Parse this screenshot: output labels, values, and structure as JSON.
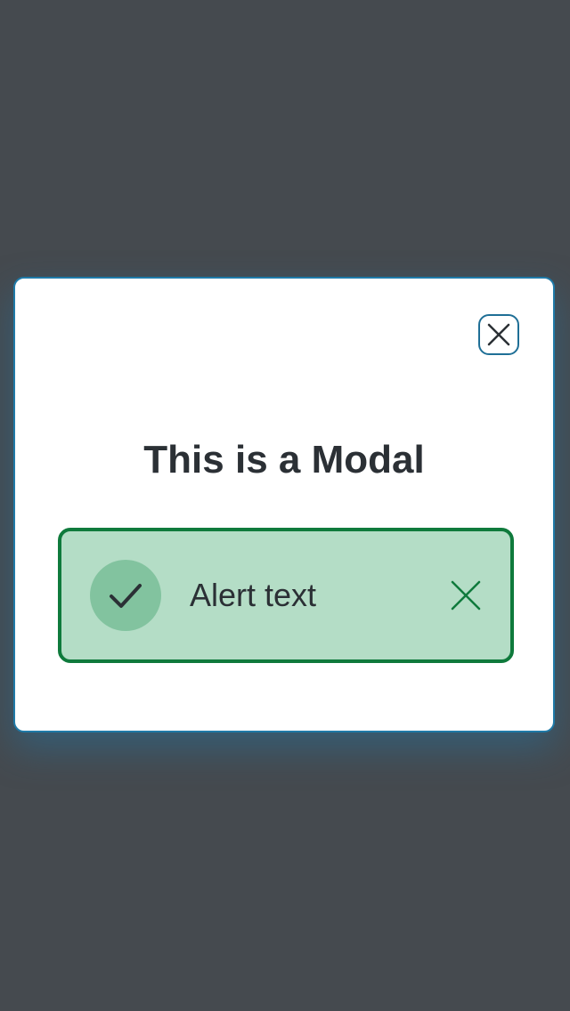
{
  "modal": {
    "title": "This is a Modal",
    "close_icon": "close-icon"
  },
  "alert": {
    "text": "Alert text",
    "status_icon": "checkmark-icon",
    "close_icon": "close-icon",
    "type": "success"
  },
  "colors": {
    "backdrop": "#454a4f",
    "modal_border": "#1f7aa8",
    "alert_background": "#b4ddc6",
    "alert_border": "#0f7a3c",
    "alert_icon_circle": "#82c39f",
    "text": "#2b3035"
  }
}
